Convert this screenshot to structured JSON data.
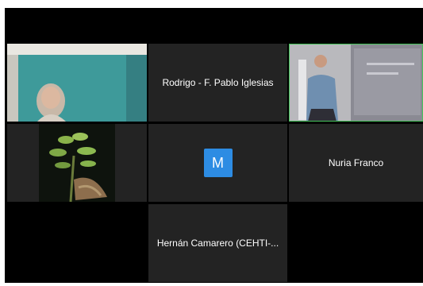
{
  "meeting": {
    "participants": [
      {
        "id": "p1",
        "name": "",
        "has_video": true
      },
      {
        "id": "p2",
        "name": "Rodrigo - F. Pablo Iglesias",
        "has_video": false
      },
      {
        "id": "p3",
        "name": "",
        "has_video": true,
        "active_speaker": true
      },
      {
        "id": "p4",
        "name": "",
        "has_video": true
      },
      {
        "id": "p5",
        "name": "",
        "has_video": false,
        "avatar_letter": "M"
      },
      {
        "id": "p6",
        "name": "Nuria Franco",
        "has_video": false
      },
      {
        "id": "p7",
        "name": "Hernán Camarero (CEHTI-...",
        "has_video": false
      }
    ],
    "colors": {
      "background": "#000000",
      "tile": "#232323",
      "active_border": "#46c35a",
      "avatar_blue": "#2d8ce3"
    }
  }
}
